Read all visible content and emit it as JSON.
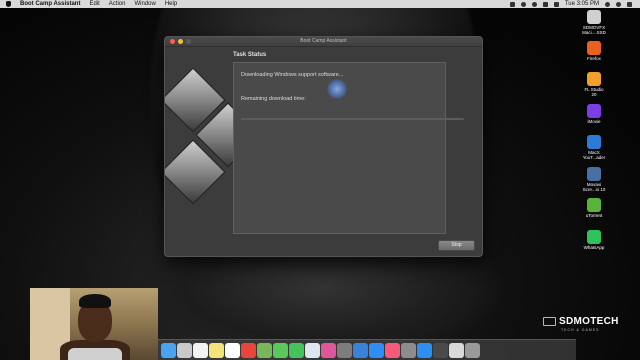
{
  "menubar": {
    "app_name": "Boot Camp Assistant",
    "menus": [
      "Edit",
      "Action",
      "Window",
      "Help"
    ],
    "clock": "Tue 3:05 PM"
  },
  "desktop_icons": [
    {
      "label": "SDMOVFX\nMaci....SSD",
      "icon": "drive-icon",
      "color": "#d0d0d0"
    },
    {
      "label": "Firefox",
      "icon": "firefox-icon",
      "color": "#e8611f"
    },
    {
      "label": "FL Studio\n20",
      "icon": "fl-studio-icon",
      "color": "#f3a02b"
    },
    {
      "label": "iMovie",
      "icon": "imovie-icon",
      "color": "#7b3fe4"
    },
    {
      "label": "MacX\nYouT...ader",
      "icon": "macx-icon",
      "color": "#2d7bd8"
    },
    {
      "label": "Movavi\nScre...io 10",
      "icon": "movavi-icon",
      "color": "#4a6fa5"
    },
    {
      "label": "uTorrent",
      "icon": "utorrent-icon",
      "color": "#5cb33b"
    },
    {
      "label": "WhatsApp",
      "icon": "whatsapp-icon",
      "color": "#2fc45b"
    }
  ],
  "window": {
    "title": "Boot Camp Assistant",
    "heading": "Task Status",
    "status_text": "Downloading Windows support software...",
    "remaining_label": "Remaining download time:",
    "progress": 0.0,
    "stop_label": "Stop"
  },
  "dock": {
    "icons": [
      "finder-icon",
      "launchpad-icon",
      "calendar-icon",
      "notes-icon",
      "photos-icon",
      "chrome-icon",
      "maps-icon",
      "messages-icon",
      "facetime-icon",
      "preview-icon",
      "itunes-icon",
      "photo-booth-icon",
      "keynote-icon",
      "app-store-icon",
      "music-icon",
      "system-preferences-icon",
      "safari-icon",
      "activity-icon",
      "file-icon",
      "trash-icon"
    ],
    "colors": [
      "#4aa3f0",
      "#c9c9c9",
      "#f2f2f2",
      "#f4e27a",
      "#ffffff",
      "#e9453a",
      "#78b85b",
      "#5bc85b",
      "#46c35a",
      "#dfe6f0",
      "#e0569a",
      "#7d7d7d",
      "#3a82d8",
      "#2e8ef5",
      "#f55a7a",
      "#8d8d8d",
      "#2d90f0",
      "#4a4a4a",
      "#d9d9d9",
      "#9a9a9a"
    ]
  },
  "watermark": {
    "name": "SDMOTECH",
    "tagline": "TECH & GAMES"
  }
}
